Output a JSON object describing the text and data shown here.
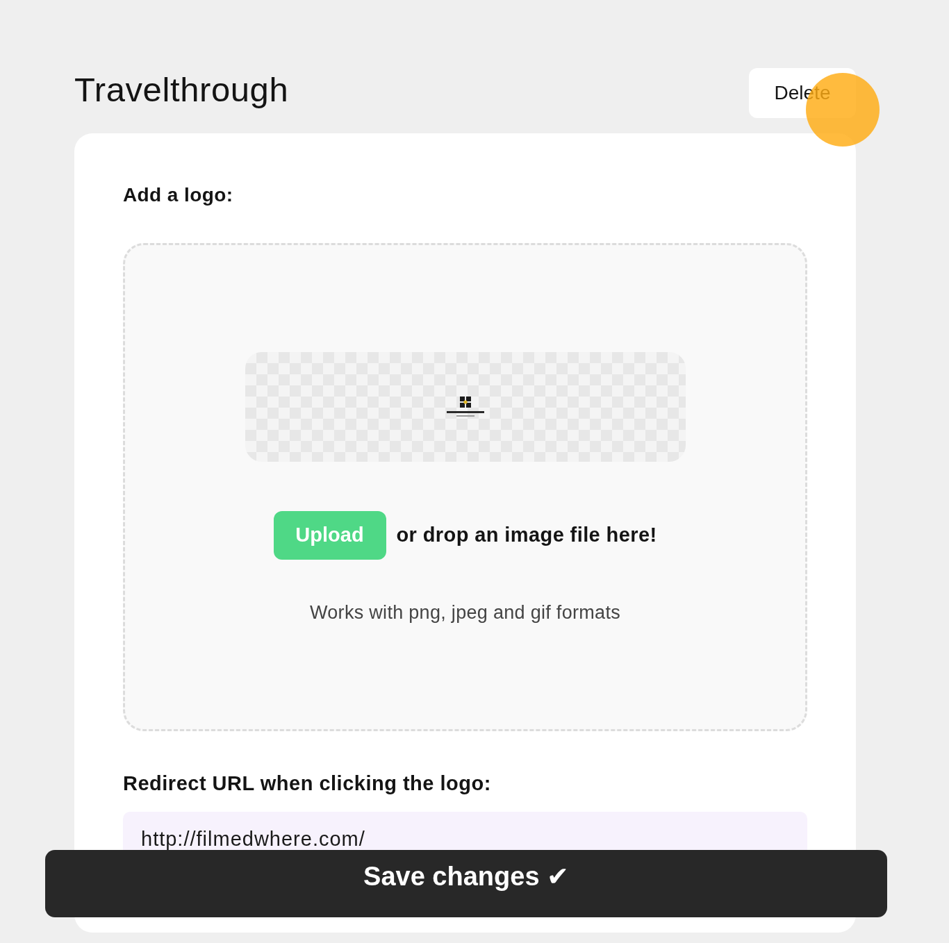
{
  "header": {
    "title": "Travelthrough",
    "delete_button": "Delete"
  },
  "cursor_highlight": true,
  "logo_section": {
    "label": "Add a logo:",
    "preview": {
      "has_logo": true
    },
    "upload_button": "Upload",
    "drop_hint": "or drop an image file here!",
    "formats_note": "Works with png, jpeg and gif formats"
  },
  "redirect": {
    "label": "Redirect URL when clicking the logo:",
    "value": "http://filmedwhere.com/"
  },
  "save_bar": {
    "label": "Save changes ✔"
  }
}
